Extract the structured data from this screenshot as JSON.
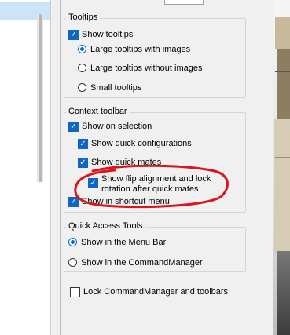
{
  "tooltips": {
    "title": "Tooltips",
    "show_tooltips": {
      "label": "Show tooltips",
      "checked": true
    },
    "size_options": [
      {
        "label": "Large tooltips with images",
        "selected": true
      },
      {
        "label": "Large tooltips without images",
        "selected": false
      },
      {
        "label": "Small tooltips",
        "selected": false
      }
    ]
  },
  "context_toolbar": {
    "title": "Context toolbar",
    "show_on_selection": {
      "label": "Show on selection",
      "checked": true
    },
    "show_quick_configurations": {
      "label": "Show quick configurations",
      "checked": true
    },
    "show_quick_mates": {
      "label": "Show quick mates",
      "checked": true
    },
    "show_flip_alignment": {
      "label_line1": "Show flip alignment and lock",
      "label_line2": "rotation after quick mates",
      "checked": true
    },
    "show_in_shortcut_menu": {
      "label": "Show in shortcut menu",
      "checked": true
    }
  },
  "quick_access_tools": {
    "title": "Quick Access Tools",
    "options": [
      {
        "label": "Show in the Menu Bar",
        "selected": true
      },
      {
        "label": "Show in the CommandManager",
        "selected": false
      }
    ]
  },
  "lock_commandmanager": {
    "label": "Lock CommandManager and toolbars",
    "checked": false
  },
  "colors": {
    "accent": "#0a66c8",
    "annotation": "#d8161c",
    "selection": "#cce4f7"
  }
}
